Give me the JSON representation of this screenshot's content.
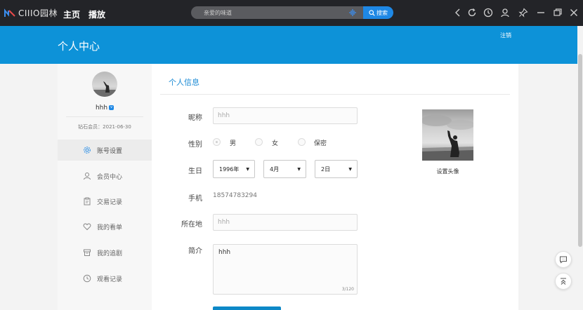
{
  "topbar": {
    "logo_text": "CIIIO园林",
    "nav": [
      "主页",
      "播放"
    ],
    "search": {
      "placeholder": "亲爱的味道",
      "button_label": "搜索"
    }
  },
  "header": {
    "title": "个人中心",
    "logout_label": "注销"
  },
  "sidebar": {
    "username": "hhh",
    "vip_badge": "v",
    "membership": "钻石会员：2021-06-30",
    "items": [
      {
        "label": "账号设置",
        "icon": "gear-icon",
        "active": true
      },
      {
        "label": "会员中心",
        "icon": "user-icon",
        "active": false
      },
      {
        "label": "交易记录",
        "icon": "clipboard-icon",
        "active": false
      },
      {
        "label": "我的看单",
        "icon": "heart-icon",
        "active": false
      },
      {
        "label": "我的追剧",
        "icon": "box-icon",
        "active": false
      },
      {
        "label": "观看记录",
        "icon": "clock-icon",
        "active": false
      }
    ]
  },
  "profile": {
    "section_title": "个人信息",
    "nickname": {
      "label": "昵称",
      "placeholder": "hhh"
    },
    "gender": {
      "label": "性别",
      "options": [
        "男",
        "女",
        "保密"
      ],
      "selected": "男"
    },
    "birthday": {
      "label": "生日",
      "year": "1996年",
      "month": "4月",
      "day": "2日"
    },
    "phone": {
      "label": "手机",
      "value": "18574783294"
    },
    "location": {
      "label": "所在地",
      "placeholder": "hhh"
    },
    "bio": {
      "label": "简介",
      "value": "hhh",
      "counter": "3/120"
    },
    "avatar_caption": "设置头像"
  },
  "colors": {
    "accent": "#0d92d8",
    "topbar": "#232428",
    "search_button": "#1e88e5"
  }
}
